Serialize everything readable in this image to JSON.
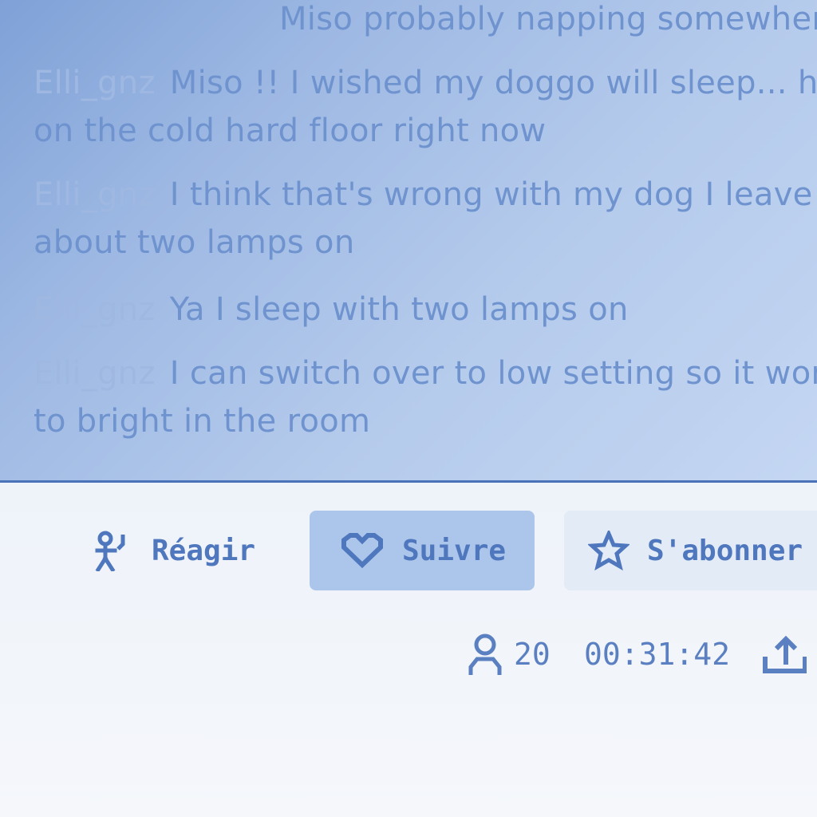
{
  "chat": {
    "messages": [
      {
        "user": "",
        "text": "Miso probably napping somewhere"
      },
      {
        "user": "Elli_gnz",
        "text": "Miso !! I wished my doggo will sleep... he's on the cold hard floor right now"
      },
      {
        "user": "Elli_gnz",
        "text": "I think that's wrong with my dog I leave about two lamps on"
      },
      {
        "user": "Elli_gnz",
        "text": "Ya I sleep with two lamps on"
      },
      {
        "user": "Elli_gnz",
        "text": "I can switch over to low setting so it won't be to bright in the room"
      }
    ]
  },
  "actions": {
    "react_label": "Réagir",
    "follow_label": "Suivre",
    "subscribe_label": "S'abonner"
  },
  "stats": {
    "viewers": "20",
    "uptime": "00:31:42"
  },
  "colors": {
    "accent": "#4f77bd",
    "follow_bg": "#acc5ea",
    "chat_bg": "#9db8e3"
  },
  "icons": {
    "react": "react-icon",
    "follow": "heart-icon",
    "subscribe": "star-icon",
    "viewers": "person-icon",
    "share": "share-icon"
  }
}
